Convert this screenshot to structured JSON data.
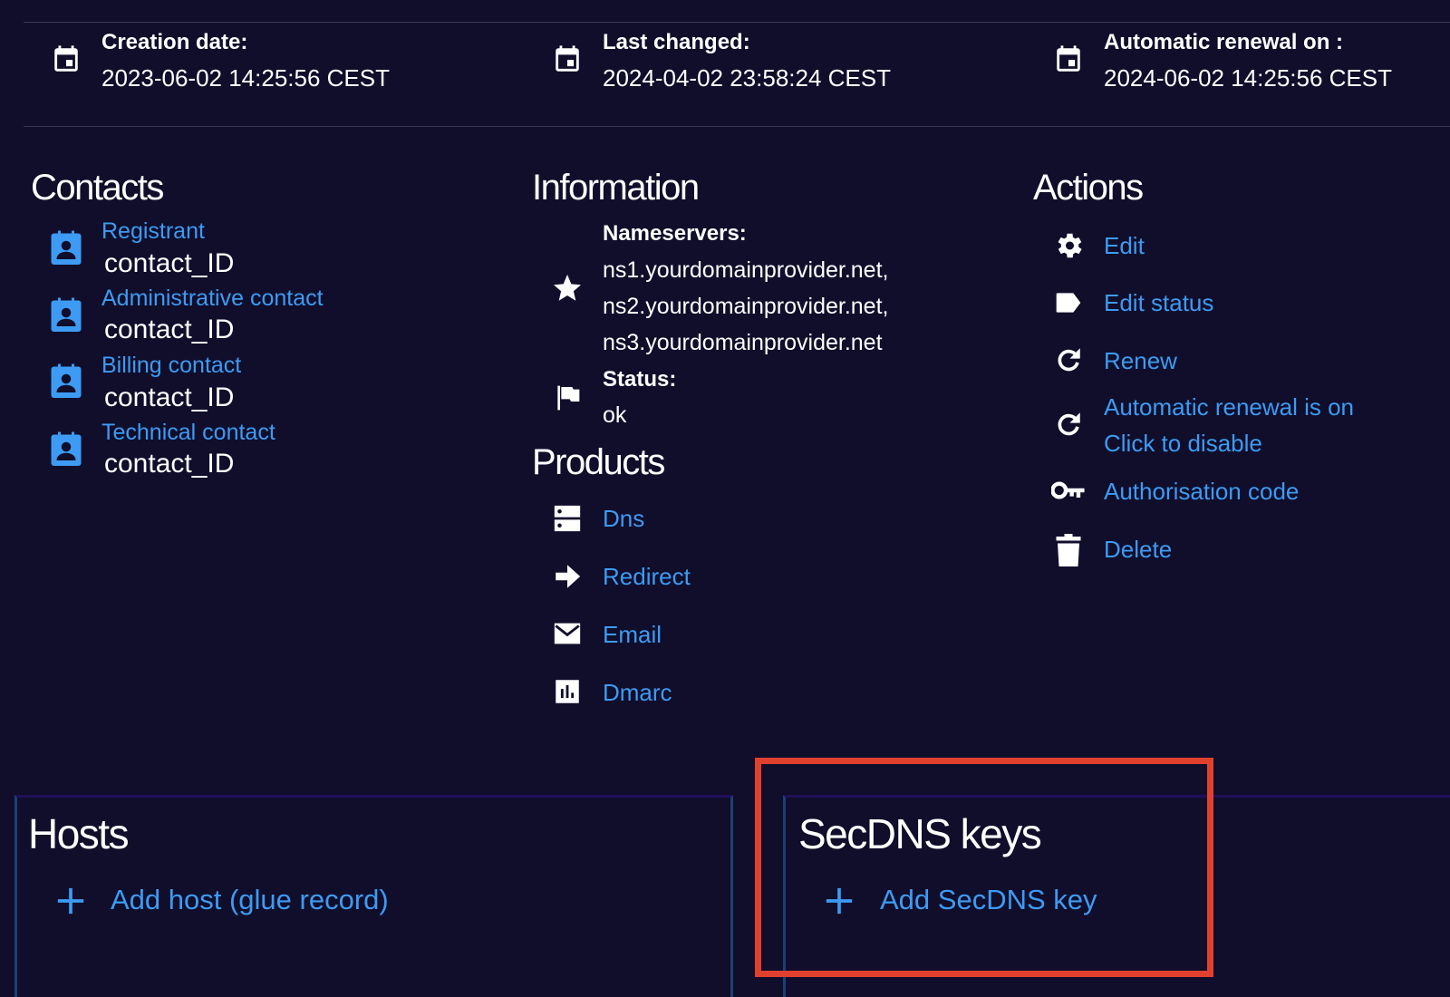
{
  "dates": {
    "creation": {
      "label": "Creation date:",
      "value": "2023-06-02 14:25:56 CEST",
      "icon": "calendar-icon"
    },
    "last_changed": {
      "label": "Last changed:",
      "value": "2024-04-02 23:58:24 CEST",
      "icon": "calendar-icon"
    },
    "renewal": {
      "label": "Automatic renewal on :",
      "value": "2024-06-02 14:25:56 CEST",
      "icon": "calendar-icon"
    }
  },
  "contacts": {
    "title": "Contacts",
    "items": [
      {
        "role": "Registrant",
        "value": "contact_ID",
        "icon": "contact-card-icon"
      },
      {
        "role": "Administrative contact",
        "value": "contact_ID",
        "icon": "contact-card-icon"
      },
      {
        "role": "Billing contact",
        "value": "contact_ID",
        "icon": "contact-card-icon"
      },
      {
        "role": "Technical contact",
        "value": "contact_ID",
        "icon": "contact-card-icon"
      }
    ]
  },
  "information": {
    "title": "Information",
    "nameservers_label": "Nameservers:",
    "nameservers": [
      "ns1.yourdomainprovider.net,",
      "ns2.yourdomainprovider.net,",
      "ns3.yourdomainprovider.net"
    ],
    "status_label": "Status:",
    "status_value": "ok"
  },
  "products": {
    "title": "Products",
    "items": [
      {
        "label": "Dns",
        "icon": "dns-icon"
      },
      {
        "label": "Redirect",
        "icon": "arrow-right-icon"
      },
      {
        "label": "Email",
        "icon": "envelope-icon"
      },
      {
        "label": "Dmarc",
        "icon": "bar-chart-icon"
      }
    ]
  },
  "actions": {
    "title": "Actions",
    "items": [
      {
        "label": "Edit",
        "icon": "gear-icon"
      },
      {
        "label": "Edit status",
        "icon": "tag-icon"
      },
      {
        "label": "Renew",
        "icon": "refresh-icon"
      },
      {
        "label": "Automatic renewal is on",
        "label2": "Click to disable",
        "icon": "refresh-icon"
      },
      {
        "label": "Authorisation code",
        "icon": "key-icon"
      },
      {
        "label": "Delete",
        "icon": "trash-icon"
      }
    ]
  },
  "hosts": {
    "title": "Hosts",
    "add_label": "Add host (glue record)"
  },
  "secdns": {
    "title": "SecDNS keys",
    "add_label": "Add SecDNS key"
  },
  "colors": {
    "background": "#100e2b",
    "link": "#3d9bf3",
    "highlight": "#e0402e"
  }
}
